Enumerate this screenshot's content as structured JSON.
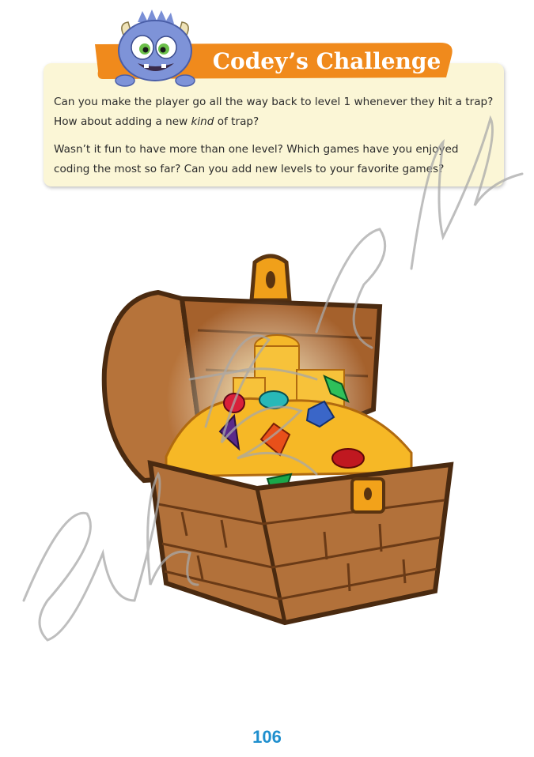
{
  "challenge": {
    "title": "Codey’s Challenge",
    "paragraph1_a": "Can you make the player go all the way back to level 1 whenever they hit a trap? How about adding a new ",
    "paragraph1_em": "kind",
    "paragraph1_b": " of trap?",
    "paragraph2": "Wasn’t it fun to have more than one level? Which games have you enjoyed coding the most so far? Can you add new levels to your favorite games?",
    "mascot_icon": "monster-mascot-icon"
  },
  "illustration": {
    "icon": "treasure-chest-icon"
  },
  "colors": {
    "banner": "#f08a1c",
    "box": "#fbf6d6",
    "page_number": "#1f8fce"
  },
  "page_number": "106"
}
